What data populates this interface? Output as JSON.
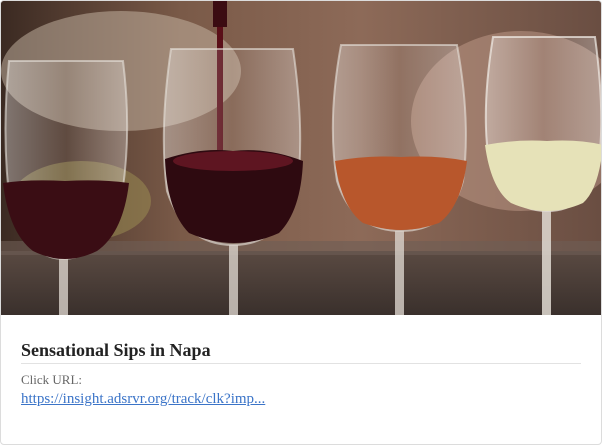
{
  "ad": {
    "image_subject": "Four wine glasses (red, red being poured, rosé, white) on a bar counter",
    "title": "Sensational Sips in Napa",
    "click_url_label": "Click URL:",
    "click_url": "https://insight.adsrvr.org/track/clk?imp..."
  },
  "colors": {
    "link": "#3b74c8",
    "title": "#222222",
    "label": "#666666"
  }
}
